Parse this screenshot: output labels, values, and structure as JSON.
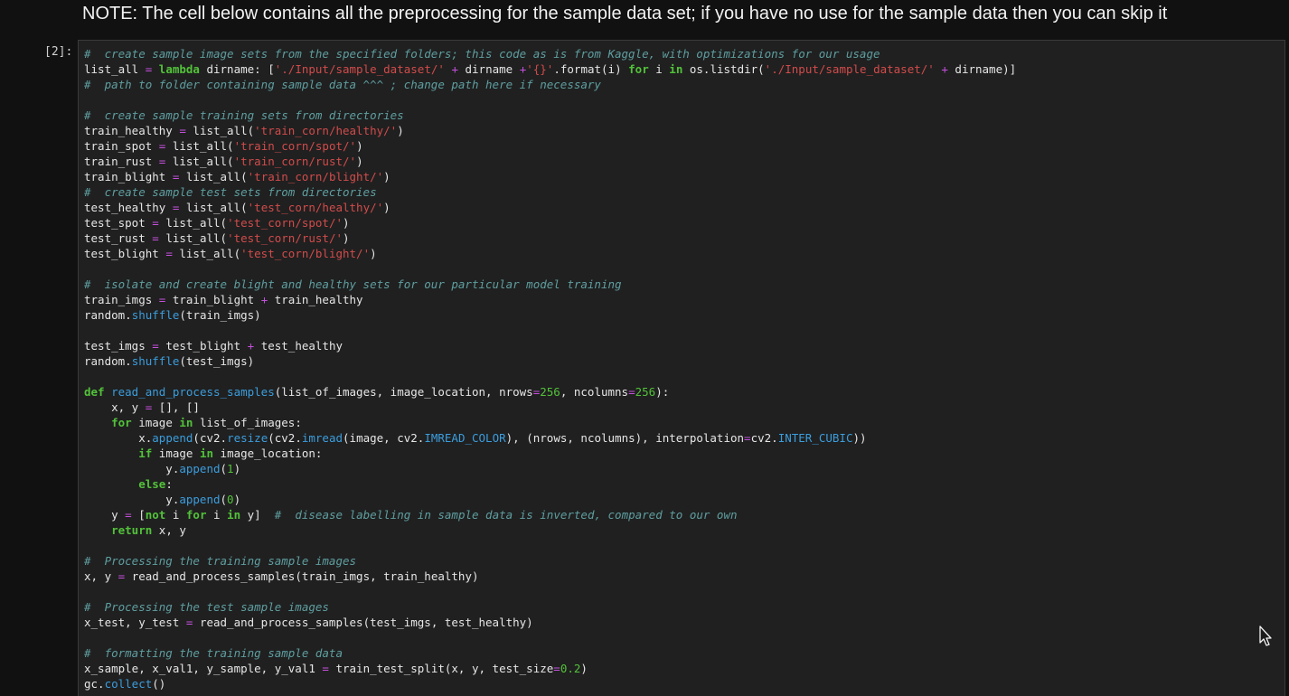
{
  "markdown": {
    "note": "NOTE: The cell below contains all the preprocessing for the sample data set; if you have no use for the sample data then you can skip it"
  },
  "code_cell": {
    "prompt": "[2]:",
    "lines": [
      [
        [
          "comment",
          "#  create sample image sets from the specified folders; this code as is from Kaggle, with optimizations for our usage"
        ]
      ],
      [
        [
          "text",
          "list_all "
        ],
        [
          "operator",
          "="
        ],
        [
          "text",
          " "
        ],
        [
          "keyword",
          "lambda"
        ],
        [
          "text",
          " dirname: ["
        ],
        [
          "string",
          "'./Input/sample_dataset/'"
        ],
        [
          "text",
          " "
        ],
        [
          "operator",
          "+"
        ],
        [
          "text",
          " dirname "
        ],
        [
          "operator",
          "+"
        ],
        [
          "string",
          "'{}'"
        ],
        [
          "text",
          ".format(i) "
        ],
        [
          "keyword",
          "for"
        ],
        [
          "text",
          " i "
        ],
        [
          "keyword",
          "in"
        ],
        [
          "text",
          " os.listdir("
        ],
        [
          "string",
          "'./Input/sample_dataset/'"
        ],
        [
          "text",
          " "
        ],
        [
          "operator",
          "+"
        ],
        [
          "text",
          " dirname)]"
        ]
      ],
      [
        [
          "comment",
          "#  path to folder containing sample data ^^^ ; change path here if necessary"
        ]
      ],
      [],
      [
        [
          "comment",
          "#  create sample training sets from directories"
        ]
      ],
      [
        [
          "text",
          "train_healthy "
        ],
        [
          "operator",
          "="
        ],
        [
          "text",
          " list_all("
        ],
        [
          "string",
          "'train_corn/healthy/'"
        ],
        [
          "text",
          ")"
        ]
      ],
      [
        [
          "text",
          "train_spot "
        ],
        [
          "operator",
          "="
        ],
        [
          "text",
          " list_all("
        ],
        [
          "string",
          "'train_corn/spot/'"
        ],
        [
          "text",
          ")"
        ]
      ],
      [
        [
          "text",
          "train_rust "
        ],
        [
          "operator",
          "="
        ],
        [
          "text",
          " list_all("
        ],
        [
          "string",
          "'train_corn/rust/'"
        ],
        [
          "text",
          ")"
        ]
      ],
      [
        [
          "text",
          "train_blight "
        ],
        [
          "operator",
          "="
        ],
        [
          "text",
          " list_all("
        ],
        [
          "string",
          "'train_corn/blight/'"
        ],
        [
          "text",
          ")"
        ]
      ],
      [
        [
          "comment",
          "#  create sample test sets from directories"
        ]
      ],
      [
        [
          "text",
          "test_healthy "
        ],
        [
          "operator",
          "="
        ],
        [
          "text",
          " list_all("
        ],
        [
          "string",
          "'test_corn/healthy/'"
        ],
        [
          "text",
          ")"
        ]
      ],
      [
        [
          "text",
          "test_spot "
        ],
        [
          "operator",
          "="
        ],
        [
          "text",
          " list_all("
        ],
        [
          "string",
          "'test_corn/spot/'"
        ],
        [
          "text",
          ")"
        ]
      ],
      [
        [
          "text",
          "test_rust "
        ],
        [
          "operator",
          "="
        ],
        [
          "text",
          " list_all("
        ],
        [
          "string",
          "'test_corn/rust/'"
        ],
        [
          "text",
          ")"
        ]
      ],
      [
        [
          "text",
          "test_blight "
        ],
        [
          "operator",
          "="
        ],
        [
          "text",
          " list_all("
        ],
        [
          "string",
          "'test_corn/blight/'"
        ],
        [
          "text",
          ")"
        ]
      ],
      [],
      [
        [
          "comment",
          "#  isolate and create blight and healthy sets for our particular model training"
        ]
      ],
      [
        [
          "text",
          "train_imgs "
        ],
        [
          "operator",
          "="
        ],
        [
          "text",
          " train_blight "
        ],
        [
          "operator",
          "+"
        ],
        [
          "text",
          " train_healthy"
        ]
      ],
      [
        [
          "text",
          "random."
        ],
        [
          "func",
          "shuffle"
        ],
        [
          "text",
          "(train_imgs)"
        ]
      ],
      [],
      [
        [
          "text",
          "test_imgs "
        ],
        [
          "operator",
          "="
        ],
        [
          "text",
          " test_blight "
        ],
        [
          "operator",
          "+"
        ],
        [
          "text",
          " test_healthy"
        ]
      ],
      [
        [
          "text",
          "random."
        ],
        [
          "func",
          "shuffle"
        ],
        [
          "text",
          "(test_imgs)"
        ]
      ],
      [],
      [
        [
          "keyword",
          "def"
        ],
        [
          "text",
          " "
        ],
        [
          "func",
          "read_and_process_samples"
        ],
        [
          "text",
          "(list_of_images, image_location, nrows"
        ],
        [
          "operator",
          "="
        ],
        [
          "number",
          "256"
        ],
        [
          "text",
          ", ncolumns"
        ],
        [
          "operator",
          "="
        ],
        [
          "number",
          "256"
        ],
        [
          "text",
          "):"
        ]
      ],
      [
        [
          "text",
          "    x, y "
        ],
        [
          "operator",
          "="
        ],
        [
          "text",
          " [], []"
        ]
      ],
      [
        [
          "text",
          "    "
        ],
        [
          "keyword",
          "for"
        ],
        [
          "text",
          " image "
        ],
        [
          "keyword",
          "in"
        ],
        [
          "text",
          " list_of_images:"
        ]
      ],
      [
        [
          "text",
          "        x."
        ],
        [
          "func",
          "append"
        ],
        [
          "text",
          "(cv2."
        ],
        [
          "func",
          "resize"
        ],
        [
          "text",
          "(cv2."
        ],
        [
          "func",
          "imread"
        ],
        [
          "text",
          "(image, cv2."
        ],
        [
          "func",
          "IMREAD_COLOR"
        ],
        [
          "text",
          "), (nrows, ncolumns), interpolation"
        ],
        [
          "operator",
          "="
        ],
        [
          "text",
          "cv2."
        ],
        [
          "func",
          "INTER_CUBIC"
        ],
        [
          "text",
          "))"
        ]
      ],
      [
        [
          "text",
          "        "
        ],
        [
          "keyword",
          "if"
        ],
        [
          "text",
          " image "
        ],
        [
          "keyword",
          "in"
        ],
        [
          "text",
          " image_location:"
        ]
      ],
      [
        [
          "text",
          "            y."
        ],
        [
          "func",
          "append"
        ],
        [
          "text",
          "("
        ],
        [
          "number",
          "1"
        ],
        [
          "text",
          ")"
        ]
      ],
      [
        [
          "text",
          "        "
        ],
        [
          "keyword",
          "else"
        ],
        [
          "text",
          ":"
        ]
      ],
      [
        [
          "text",
          "            y."
        ],
        [
          "func",
          "append"
        ],
        [
          "text",
          "("
        ],
        [
          "number",
          "0"
        ],
        [
          "text",
          ")"
        ]
      ],
      [
        [
          "text",
          "    y "
        ],
        [
          "operator",
          "="
        ],
        [
          "text",
          " ["
        ],
        [
          "keyword",
          "not"
        ],
        [
          "text",
          " i "
        ],
        [
          "keyword",
          "for"
        ],
        [
          "text",
          " i "
        ],
        [
          "keyword",
          "in"
        ],
        [
          "text",
          " y]  "
        ],
        [
          "comment",
          "#  disease labelling in sample data is inverted, compared to our own"
        ]
      ],
      [
        [
          "text",
          "    "
        ],
        [
          "keyword",
          "return"
        ],
        [
          "text",
          " x, y"
        ]
      ],
      [],
      [
        [
          "comment",
          "#  Processing the training sample images"
        ]
      ],
      [
        [
          "text",
          "x, y "
        ],
        [
          "operator",
          "="
        ],
        [
          "text",
          " read_and_process_samples(train_imgs, train_healthy)"
        ]
      ],
      [],
      [
        [
          "comment",
          "#  Processing the test sample images"
        ]
      ],
      [
        [
          "text",
          "x_test, y_test "
        ],
        [
          "operator",
          "="
        ],
        [
          "text",
          " read_and_process_samples(test_imgs, test_healthy)"
        ]
      ],
      [],
      [
        [
          "comment",
          "#  formatting the training sample data"
        ]
      ],
      [
        [
          "text",
          "x_sample, x_val1, y_sample, y_val1 "
        ],
        [
          "operator",
          "="
        ],
        [
          "text",
          " train_test_split(x, y, test_size"
        ],
        [
          "operator",
          "="
        ],
        [
          "number",
          "0.2"
        ],
        [
          "text",
          ")"
        ]
      ],
      [
        [
          "text",
          "gc."
        ],
        [
          "func",
          "collect"
        ],
        [
          "text",
          "()"
        ]
      ]
    ]
  },
  "colors": {
    "background": "#111111",
    "editor_background": "#202020",
    "comment": "#5f9ea0",
    "keyword": "#52c23a",
    "string": "#d24b4b",
    "operator": "#c44fdb",
    "function": "#3b9ddd"
  },
  "icons": {
    "mouse_cursor": "mouse-pointer-icon"
  }
}
